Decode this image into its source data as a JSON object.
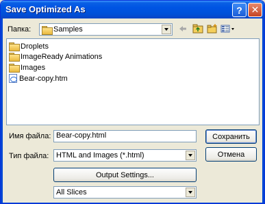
{
  "window": {
    "title": "Save Optimized As",
    "help_label": "?",
    "close_label": "✕"
  },
  "lookin": {
    "label": "Папка:",
    "value": "Samples"
  },
  "toolbar": {
    "icons": [
      "back-arrow-icon",
      "up-folder-icon",
      "new-folder-icon",
      "view-menu-icon"
    ]
  },
  "files": {
    "items": [
      {
        "label": "Droplets",
        "icon": "folder-icon"
      },
      {
        "label": "ImageReady Animations",
        "icon": "folder-icon"
      },
      {
        "label": "Images",
        "icon": "folder-icon"
      },
      {
        "label": "Bear-copy.htm",
        "icon": "html-file-icon"
      }
    ]
  },
  "filename": {
    "label": "Имя файла:",
    "value": "Bear-copy.html"
  },
  "filetype": {
    "label": "Тип файла:",
    "value": "HTML and Images (*.html)"
  },
  "buttons": {
    "save": "Сохранить",
    "cancel": "Отмена",
    "output_settings": "Output Settings..."
  },
  "slices": {
    "value": "All Slices"
  },
  "colors": {
    "titlebar": "#0054e3",
    "dialog_bg": "#ece9d8",
    "field_border": "#7f9db9"
  }
}
